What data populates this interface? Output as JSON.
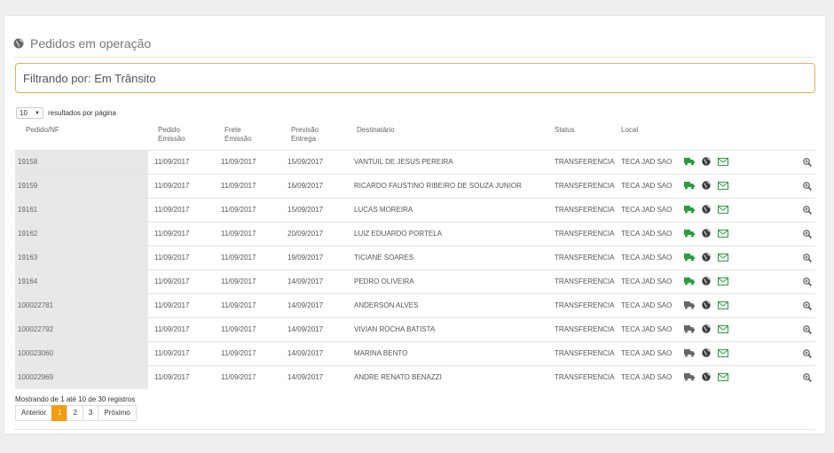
{
  "header": {
    "title": "Pedidos em operação",
    "icon": "globe-icon"
  },
  "filter": {
    "label": "Filtrando por: Em Trânsito"
  },
  "length": {
    "value": "10",
    "suffix": "resultados por página"
  },
  "columns": {
    "pedido": "Pedido/NF",
    "emissao": "Pedido Emissão",
    "frete": "Frete Emissão",
    "previsao": "Previsão Entrega",
    "destinatario": "Destinatário",
    "status": "Status",
    "local": "Local"
  },
  "colors": {
    "truck_green": "#2a9d3c",
    "truck_gray": "#666666",
    "accent": "#f39c12",
    "mail_green": "#2a9d3c"
  },
  "rows": [
    {
      "pedido": "19158",
      "emissao": "11/09/2017",
      "frete": "11/09/2017",
      "previsao": "15/09/2017",
      "destinatario": "VANTUIL DE JESUS PEREIRA",
      "status": "TRANSFERENCIA",
      "local": "TECA JAD SAO",
      "truck": "green"
    },
    {
      "pedido": "19159",
      "emissao": "11/09/2017",
      "frete": "11/09/2017",
      "previsao": "16/09/2017",
      "destinatario": "RICARDO FAUSTINO RIBEIRO DE SOUZA JUNIOR",
      "status": "TRANSFERENCIA",
      "local": "TECA JAD SAO",
      "truck": "green"
    },
    {
      "pedido": "19161",
      "emissao": "11/09/2017",
      "frete": "11/09/2017",
      "previsao": "15/09/2017",
      "destinatario": "LUCAS MOREIRA",
      "status": "TRANSFERENCIA",
      "local": "TECA JAD SAO",
      "truck": "green"
    },
    {
      "pedido": "19162",
      "emissao": "11/09/2017",
      "frete": "11/09/2017",
      "previsao": "20/09/2017",
      "destinatario": "LUIZ EDUARDO PORTELA",
      "status": "TRANSFERENCIA",
      "local": "TECA JAD SAO",
      "truck": "green"
    },
    {
      "pedido": "19163",
      "emissao": "11/09/2017",
      "frete": "11/09/2017",
      "previsao": "19/09/2017",
      "destinatario": "TICIANE SOARES",
      "status": "TRANSFERENCIA",
      "local": "TECA JAD SAO",
      "truck": "green"
    },
    {
      "pedido": "19164",
      "emissao": "11/09/2017",
      "frete": "11/09/2017",
      "previsao": "14/09/2017",
      "destinatario": "PEDRO OLIVEIRA",
      "status": "TRANSFERENCIA",
      "local": "TECA JAD SAO",
      "truck": "green"
    },
    {
      "pedido": "100022781",
      "emissao": "11/09/2017",
      "frete": "11/09/2017",
      "previsao": "14/09/2017",
      "destinatario": "ANDERSON ALVES",
      "status": "TRANSFERENCIA",
      "local": "TECA JAD SAO",
      "truck": "gray"
    },
    {
      "pedido": "100022792",
      "emissao": "11/09/2017",
      "frete": "11/09/2017",
      "previsao": "14/09/2017",
      "destinatario": "VIVIAN ROCHA BATISTA",
      "status": "TRANSFERENCIA",
      "local": "TECA JAD SAO",
      "truck": "gray"
    },
    {
      "pedido": "100023060",
      "emissao": "11/09/2017",
      "frete": "11/09/2017",
      "previsao": "14/09/2017",
      "destinatario": "MARINA BENTO",
      "status": "TRANSFERENCIA",
      "local": "TECA JAD SAO",
      "truck": "gray"
    },
    {
      "pedido": "100022969",
      "emissao": "11/09/2017",
      "frete": "11/09/2017",
      "previsao": "14/09/2017",
      "destinatario": "ANDRE RENATO BENAZZI",
      "status": "TRANSFERENCIA",
      "local": "TECA JAD SAO",
      "truck": "gray"
    }
  ],
  "footer": {
    "info": "Mostrando de 1 até 10 de 30 registros",
    "prev": "Anterior",
    "pages": [
      "1",
      "2",
      "3"
    ],
    "active_page": "1",
    "next": "Próximo"
  }
}
